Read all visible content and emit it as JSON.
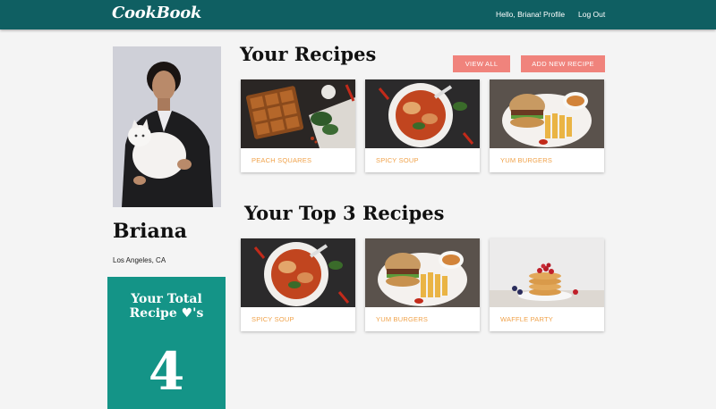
{
  "navbar": {
    "brand": "CookBook",
    "greeting": "Hello, Briana!",
    "profile_link": "Profile",
    "logout_link": "Log Out"
  },
  "profile": {
    "name": "Briana",
    "location": "Los Angeles, CA"
  },
  "hearts_card": {
    "title_line1": "Your Total",
    "title_line2": "Recipe ♥'s",
    "count": "4"
  },
  "recipes_section": {
    "title": "Your Recipes",
    "view_all_label": "VIEW ALL",
    "add_new_label": "ADD NEW RECIPE",
    "cards": [
      {
        "label": "PEACH SQUARES",
        "image": "peach-squares-photo"
      },
      {
        "label": "SPICY SOUP",
        "image": "spicy-soup-photo"
      },
      {
        "label": "YUM BURGERS",
        "image": "yum-burgers-photo"
      }
    ]
  },
  "top3_section": {
    "title": "Your Top 3 Recipes",
    "cards": [
      {
        "label": "SPICY SOUP",
        "image": "spicy-soup-photo"
      },
      {
        "label": "YUM BURGERS",
        "image": "yum-burgers-photo"
      },
      {
        "label": "WAFFLE PARTY",
        "image": "waffle-party-photo"
      }
    ]
  },
  "colors": {
    "navbar": "#0f5f62",
    "accent_button": "#f0837c",
    "card_label": "#f0a24a",
    "hearts_card": "#149487"
  }
}
